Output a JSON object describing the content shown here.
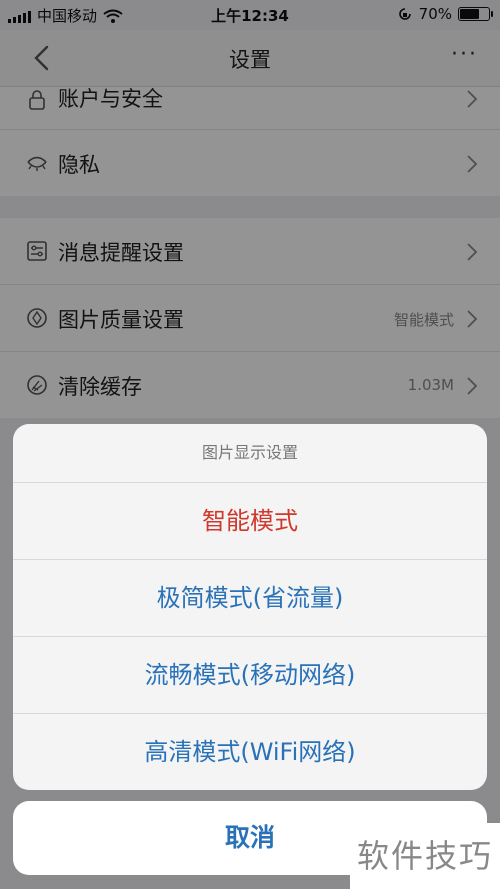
{
  "status_bar": {
    "carrier": "中国移动",
    "time": "上午12:34",
    "battery_text": "70%",
    "battery_level": 0.7
  },
  "nav": {
    "title": "设置",
    "more_label": "···"
  },
  "settings": {
    "group1": [
      {
        "label": "账户与安全",
        "icon": "lock-icon"
      },
      {
        "label": "隐私",
        "icon": "eye-closed-icon"
      }
    ],
    "group2": [
      {
        "label": "消息提醒设置",
        "icon": "sliders-icon",
        "value": ""
      },
      {
        "label": "图片质量设置",
        "icon": "image-quality-icon",
        "value": "智能模式"
      },
      {
        "label": "清除缓存",
        "icon": "broom-icon",
        "value": "1.03M"
      }
    ]
  },
  "action_sheet": {
    "title": "图片显示设置",
    "options": [
      "智能模式",
      "极简模式(省流量)",
      "流畅模式(移动网络)",
      "高清模式(WiFi网络)"
    ],
    "selected_index": 0,
    "cancel_label": "取消"
  },
  "colors": {
    "accent": "#2a72b8",
    "selected": "#d0382d"
  },
  "watermark": "软件技巧"
}
